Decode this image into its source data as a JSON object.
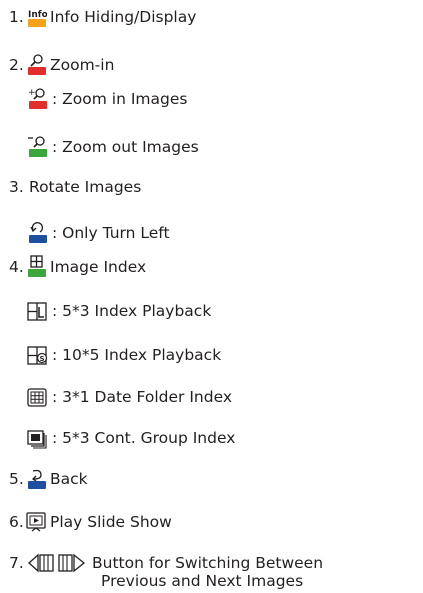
{
  "items": [
    {
      "num": "1.",
      "label": "Info Hiding/Display",
      "icon": "info-icon"
    },
    {
      "num": "2.",
      "label": "Zoom-in",
      "icon": "zoom-icon",
      "sub": [
        {
          "label": ": Zoom in Images",
          "icon": "zoom-in-icon"
        },
        {
          "label": ": Zoom out Images",
          "icon": "zoom-out-icon"
        }
      ]
    },
    {
      "num": "3.",
      "label": "Rotate Images",
      "sub": [
        {
          "label": ": Only Turn Left",
          "icon": "rotate-left-icon"
        }
      ]
    },
    {
      "num": "4.",
      "label": "Image Index",
      "icon": "image-index-icon",
      "sub": [
        {
          "label": ": 5*3 Index Playback",
          "icon": "index-5x3-icon"
        },
        {
          "label": ": 10*5 Index Playback",
          "icon": "index-10x5-icon"
        },
        {
          "label": ": 3*1 Date Folder Index",
          "icon": "date-folder-index-icon"
        },
        {
          "label": ": 5*3 Cont. Group Index",
          "icon": "cont-group-index-icon"
        }
      ]
    },
    {
      "num": "5.",
      "label": "Back",
      "icon": "back-icon"
    },
    {
      "num": "6.",
      "label": "Play Slide Show",
      "icon": "slide-show-icon"
    },
    {
      "num": "7.",
      "label": "Button for Switching Between",
      "label2": "Previous and Next Images",
      "icon": "prev-next-icon"
    }
  ],
  "colors": {
    "orange": "#f5a21b",
    "red": "#e22f2c",
    "green": "#3aa63b",
    "blue": "#1c4fa0"
  }
}
